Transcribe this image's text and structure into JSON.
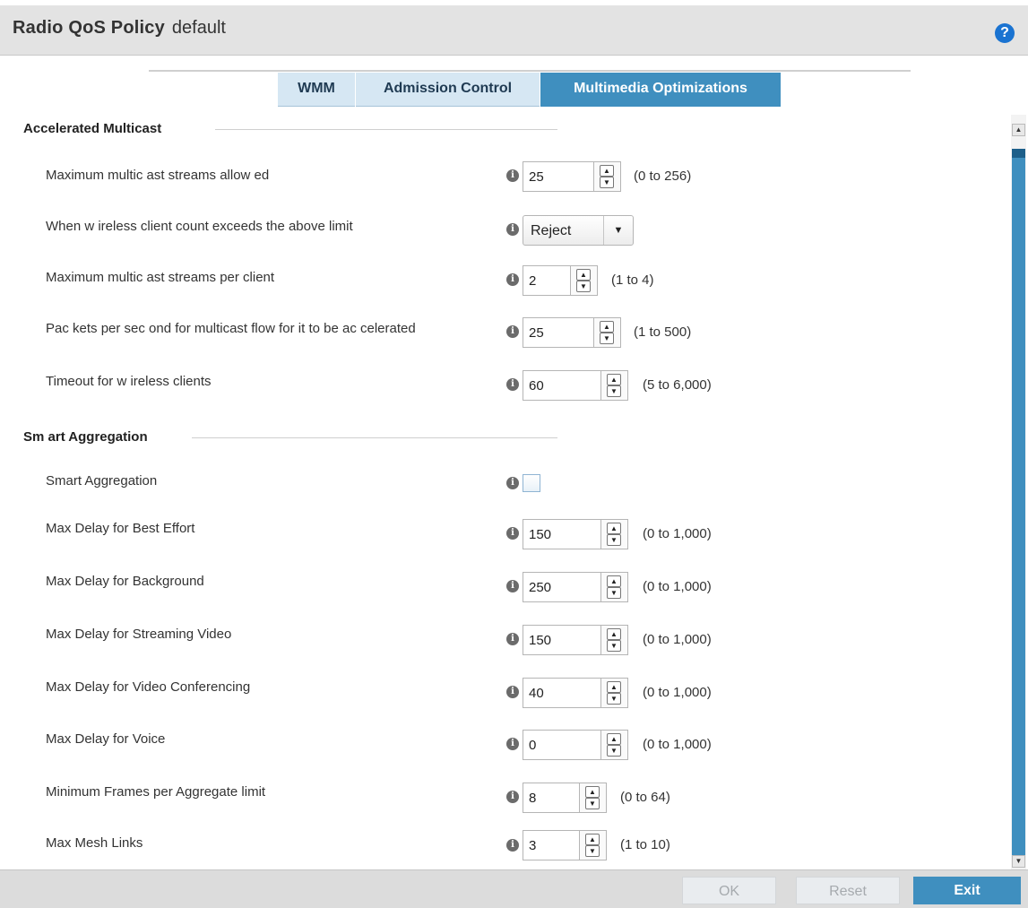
{
  "header": {
    "title": "Radio QoS Policy",
    "policy_name": "default",
    "help_icon": "question-circle-icon"
  },
  "tabs": [
    {
      "label": "WMM",
      "active": false
    },
    {
      "label": "Admission Control",
      "active": false
    },
    {
      "label": "Multimedia Optimizations",
      "active": true
    }
  ],
  "accelerated_multicast": {
    "section_title": "Accelerated Multicast",
    "max_streams": {
      "label": "Maximum multic ast streams allow ed",
      "value": "25",
      "range": "(0 to 256)"
    },
    "exceed_action": {
      "label": "When w ireless client count exceeds the above limit",
      "value": "Reject"
    },
    "streams_per_client": {
      "label": "Maximum multic ast streams per client",
      "value": "2",
      "range": "(1 to 4)"
    },
    "packets_per_second": {
      "label": "Pac kets per sec ond for multicast flow  for it to be ac celerated",
      "value": "25",
      "range": "(1 to 500)"
    },
    "timeout": {
      "label": "Timeout for w ireless clients",
      "value": "60",
      "range": "(5 to 6,000)"
    }
  },
  "smart_aggregation": {
    "section_title": "Sm art Aggregation",
    "enabled": {
      "label": "Smart Aggregation",
      "checked": false
    },
    "best_effort": {
      "label": "Max Delay for Best Effort",
      "value": "150",
      "range": "(0 to 1,000)"
    },
    "background": {
      "label": "Max Delay for  Background",
      "value": "250",
      "range": "(0 to 1,000)"
    },
    "streaming_video": {
      "label": "Max Delay for Streaming Video",
      "value": "150",
      "range": "(0 to 1,000)"
    },
    "video_conferencing": {
      "label": "Max Delay for Video Conferencing",
      "value": "40",
      "range": "(0 to 1,000)"
    },
    "voice": {
      "label": "Max Delay for Voice",
      "value": "0",
      "range": "(0 to 1,000)"
    },
    "min_frames": {
      "label": "Minimum Frames per Aggregate limit",
      "value": "8",
      "range": "(0 to 64)"
    },
    "mesh_links": {
      "label": "Max Mesh Links",
      "value": "3",
      "range": "(1 to 10)"
    }
  },
  "footer": {
    "ok_label": "OK",
    "reset_label": "Reset",
    "exit_label": "Exit"
  },
  "colors": {
    "accent": "#3f8fbf",
    "tab_inactive": "#d6e7f3",
    "header_bg": "#e3e3e3",
    "help_blue": "#1a73d1"
  }
}
